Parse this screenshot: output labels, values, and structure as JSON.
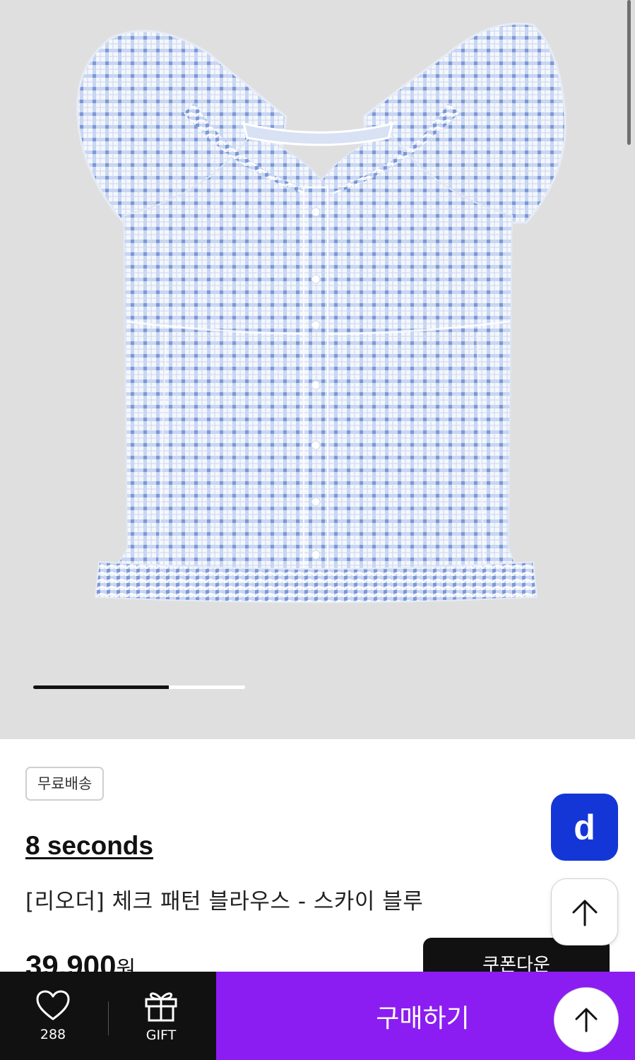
{
  "gallery": {
    "image_alt": "gingham check puff-sleeve blouse",
    "progress": 0.64
  },
  "info": {
    "badge": "무료배송",
    "brand": "8 seconds",
    "product_name": "[리오더] 체크 패턴 블라우스 - 스카이 블루",
    "price_value": "39,900",
    "price_unit": "원",
    "coupon_label": "쿠폰다운"
  },
  "floating": {
    "d_logo": "d"
  },
  "bottom_bar": {
    "like_count": "288",
    "gift_label": "GIFT",
    "buy_label": "구매하기"
  },
  "colors": {
    "buy_bg": "#8b1df2",
    "d_logo_bg": "#1536d6",
    "gingham_blue": "#8fa9dc"
  }
}
